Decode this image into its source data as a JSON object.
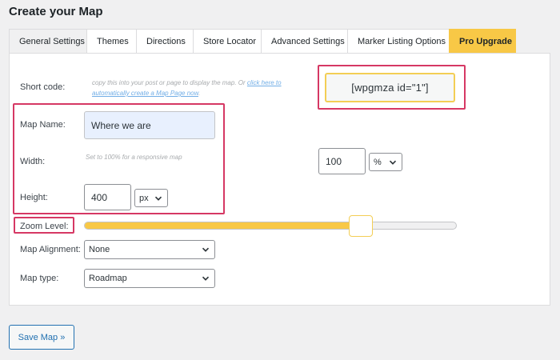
{
  "page": {
    "title": "Create your Map"
  },
  "tabs": [
    {
      "label": "General Settings"
    },
    {
      "label": "Themes"
    },
    {
      "label": "Directions"
    },
    {
      "label": "Store Locator"
    },
    {
      "label": "Advanced Settings"
    },
    {
      "label": "Marker Listing Options"
    },
    {
      "label": "Pro Upgrade"
    }
  ],
  "shortcode": {
    "label": "Short code:",
    "hint": "copy this into your post or page to display the map. Or ",
    "link": "click here to automatically create a Map Page now",
    "link_suffix": ".",
    "value": "[wpgmza id=\"1\"]"
  },
  "map_name": {
    "label": "Map Name:",
    "value": "Where we are"
  },
  "width": {
    "label": "Width:",
    "hint": "Set to 100% for a responsive map",
    "value": "100",
    "unit": "%"
  },
  "height": {
    "label": "Height:",
    "value": "400",
    "unit": "px"
  },
  "zoom": {
    "label": "Zoom Level:",
    "level_fraction": 0.76
  },
  "alignment": {
    "label": "Map Alignment:",
    "value": "None"
  },
  "map_type": {
    "label": "Map type:",
    "value": "Roadmap"
  },
  "save": {
    "label": "Save Map »"
  },
  "colors": {
    "accent": "#f8c846",
    "highlight": "#d63864",
    "link": "#2271b1"
  }
}
